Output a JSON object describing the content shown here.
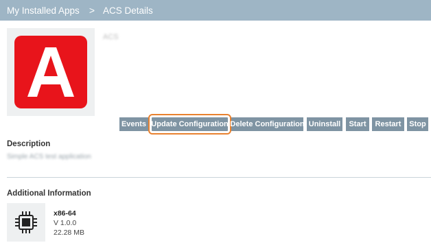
{
  "breadcrumb": {
    "root": "My Installed Apps",
    "separator": ">",
    "current": "ACS  Details"
  },
  "app": {
    "name": "ACS",
    "logo_letter": "A",
    "logo_icon": "app-logo-icon",
    "logo_color": "#e8141b"
  },
  "actions": {
    "events": "Events",
    "update_configuration": "Update Configuration",
    "delete_configuration": "Delete Configuration",
    "uninstall": "Uninstall",
    "start": "Start",
    "restart": "Restart",
    "stop": "Stop",
    "button_color": "#7f94a3",
    "focus_color": "#e8812f"
  },
  "description": {
    "heading": "Description",
    "text": "Simple ACS test application"
  },
  "additional": {
    "heading": "Additional Information",
    "icon": "cpu-chip-icon",
    "architecture": "x86-64",
    "version": "V 1.0.0",
    "size": "22.28 MB"
  },
  "colors": {
    "header_bar": "#9eb5c5",
    "divider": "#c9d3da"
  }
}
